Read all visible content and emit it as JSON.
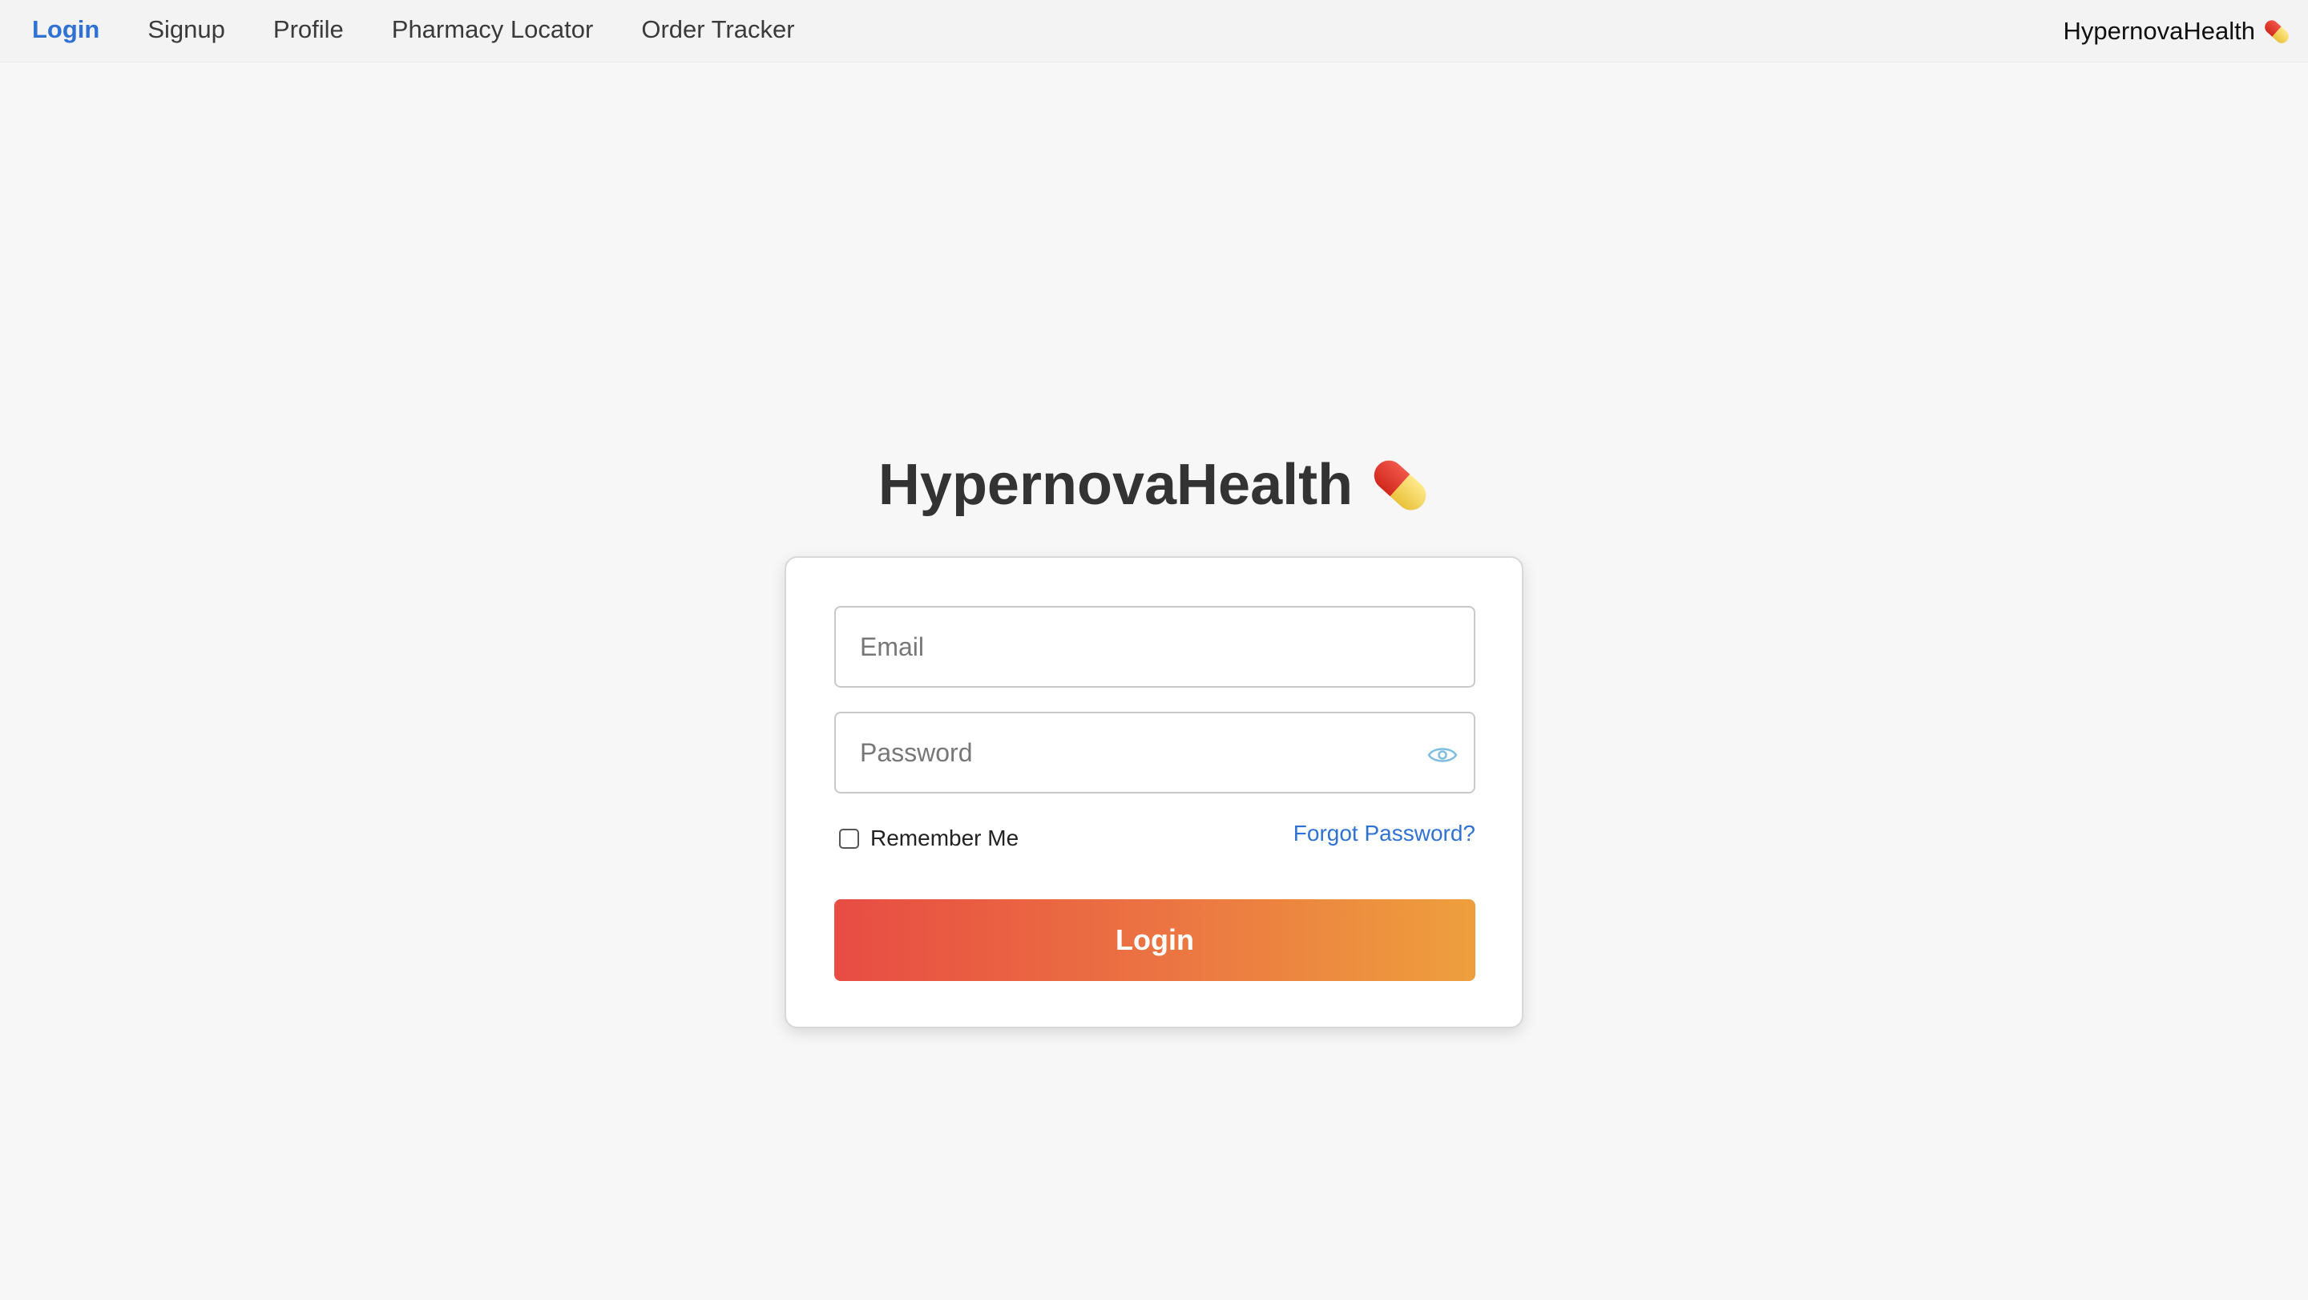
{
  "nav": {
    "links": [
      {
        "label": "Login",
        "active": true
      },
      {
        "label": "Signup",
        "active": false
      },
      {
        "label": "Profile",
        "active": false
      },
      {
        "label": "Pharmacy Locator",
        "active": false
      },
      {
        "label": "Order Tracker",
        "active": false
      }
    ],
    "brand": "HypernovaHealth",
    "brand_icon": "pill-icon"
  },
  "heading": {
    "title": "HypernovaHealth",
    "icon": "pill-icon"
  },
  "form": {
    "email": {
      "placeholder": "Email",
      "value": ""
    },
    "password": {
      "placeholder": "Password",
      "value": "",
      "toggle_icon": "eye-icon"
    },
    "remember_me": {
      "label": "Remember Me",
      "checked": false
    },
    "forgot_password": "Forgot Password?",
    "submit_label": "Login"
  },
  "colors": {
    "background": "#f7f7f7",
    "nav_background": "#f3f3f3",
    "active_link": "#2f72d4",
    "link": "#2f72d4",
    "button_gradient_start": "#e84c43",
    "button_gradient_end": "#ee9f3d",
    "pill_red": "#d9342b",
    "pill_yellow": "#f2d45c",
    "eye_icon": "#7fbde0"
  }
}
